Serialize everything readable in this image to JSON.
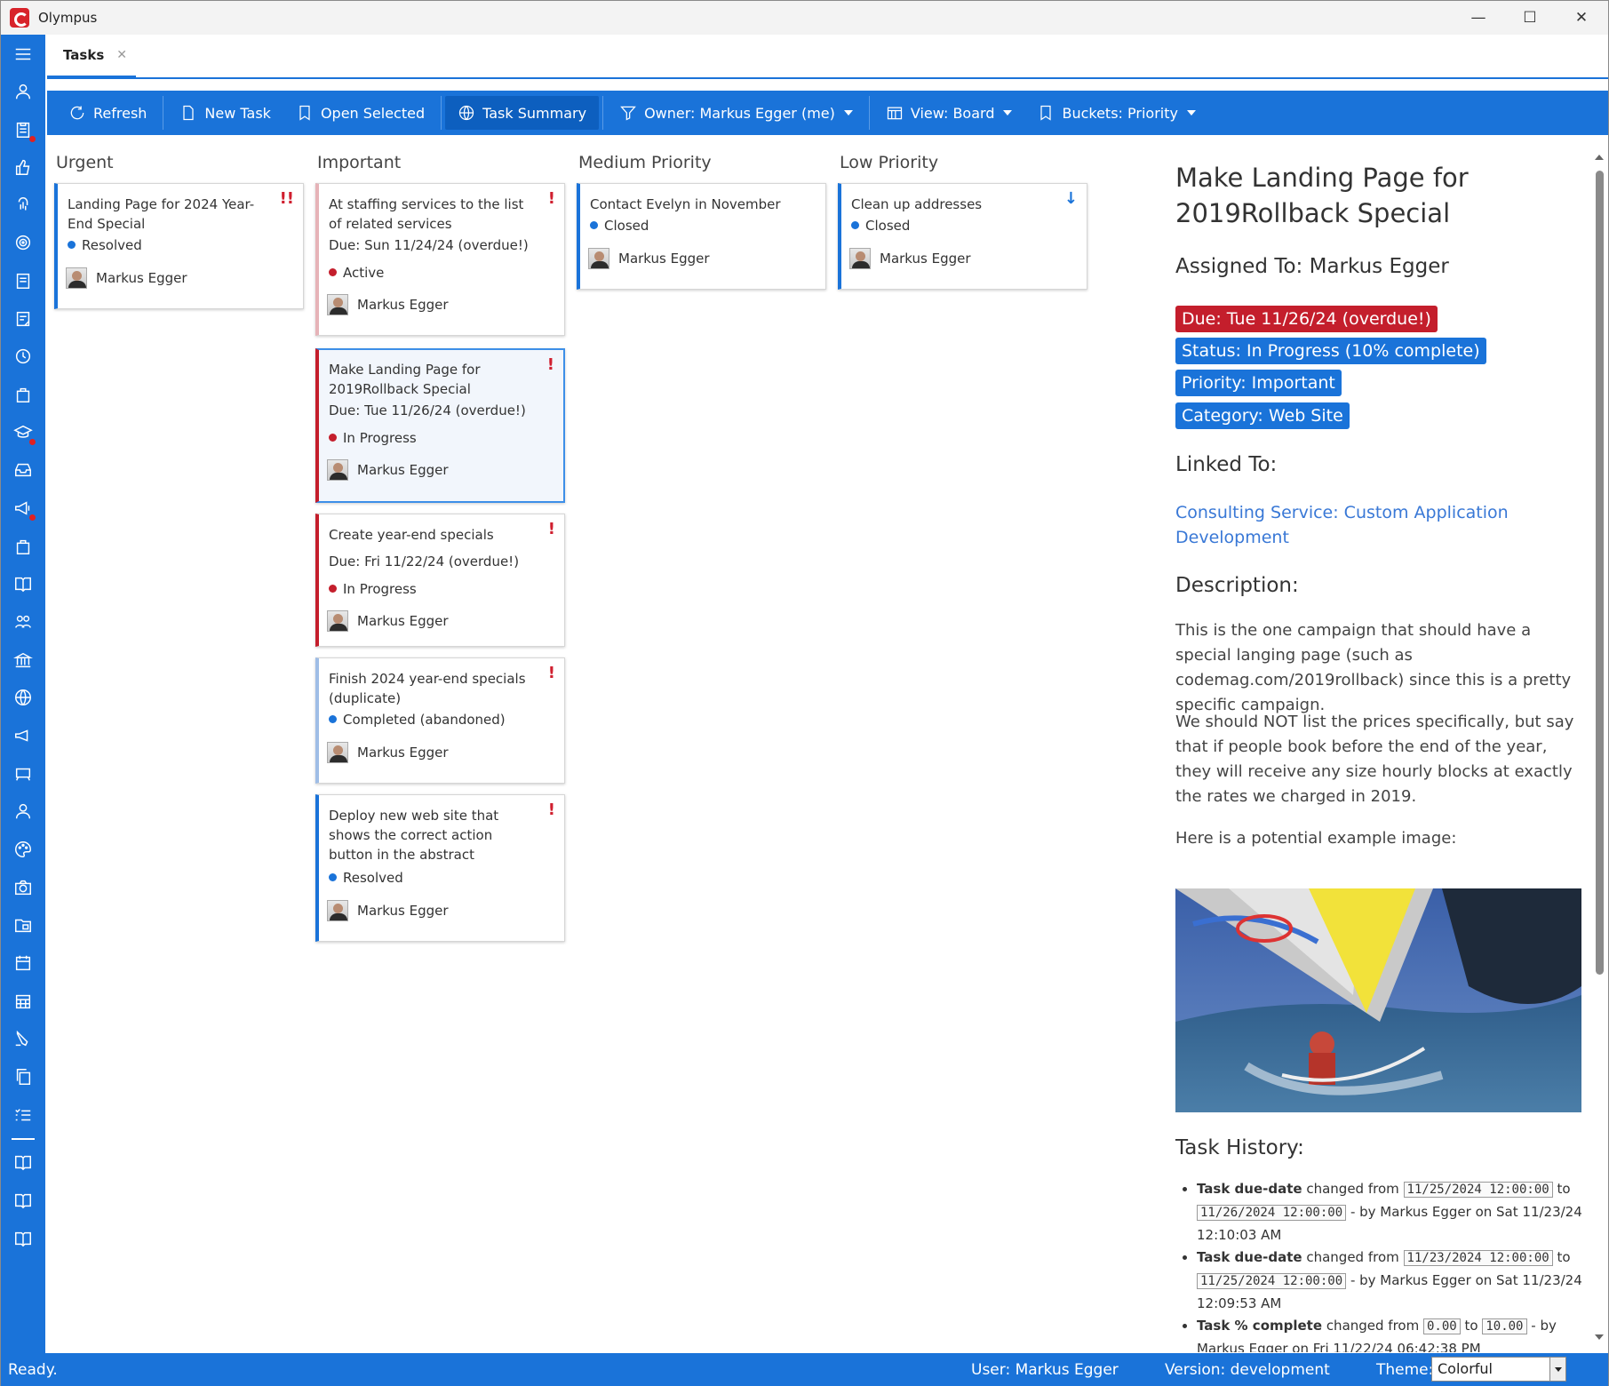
{
  "window": {
    "title": "Olympus"
  },
  "tabs": [
    {
      "label": "Tasks",
      "close": "✕"
    }
  ],
  "toolbar": {
    "refresh": "Refresh",
    "new_task": "New Task",
    "open_selected": "Open Selected",
    "task_summary": "Task Summary",
    "owner": "Owner: Markus Egger (me)",
    "view": "View: Board",
    "buckets": "Buckets: Priority"
  },
  "columns": [
    {
      "title": "Urgent"
    },
    {
      "title": "Important"
    },
    {
      "title": "Medium Priority"
    },
    {
      "title": "Low Priority"
    }
  ],
  "cards": {
    "urgent_1": {
      "title": "Landing Page for 2024 Year-End Special",
      "status": "Resolved",
      "user": "Markus Egger",
      "flag": "!!"
    },
    "imp_1": {
      "title": "At staffing services to the list of related services",
      "due": "Due: Sun 11/24/24 (overdue!)",
      "status": "Active",
      "user": "Markus Egger",
      "flag": "!"
    },
    "imp_2": {
      "title": "Make Landing Page for 2019Rollback Special",
      "due": "Due: Tue 11/26/24 (overdue!)",
      "status": "In Progress",
      "user": "Markus Egger",
      "flag": "!"
    },
    "imp_3": {
      "title": "Create year-end specials",
      "due": "Due: Fri 11/22/24 (overdue!)",
      "status": "In Progress",
      "user": "Markus Egger",
      "flag": "!"
    },
    "imp_4": {
      "title": "Finish 2024 year-end specials (duplicate)",
      "status": "Completed (abandoned)",
      "user": "Markus Egger",
      "flag": "!"
    },
    "imp_5": {
      "title": "Deploy new web site that shows the correct action button in the abstract",
      "status": "Resolved",
      "user": "Markus Egger",
      "flag": "!"
    },
    "med_1": {
      "title": "Contact Evelyn in November",
      "status": "Closed",
      "user": "Markus Egger"
    },
    "low_1": {
      "title": "Clean up addresses",
      "status": "Closed",
      "user": "Markus Egger",
      "flag": "↓"
    }
  },
  "details": {
    "title": "Make Landing Page for 2019Rollback Special",
    "assigned": "Assigned To: Markus Egger",
    "badges": {
      "due": "Due: Tue 11/26/24 (overdue!)",
      "status": "Status: In Progress (10% complete)",
      "priority": "Priority: Important",
      "category": "Category: Web Site"
    },
    "badge_colors": {
      "due": "#c41e2c",
      "info": "#1a73d9"
    },
    "linked_heading": "Linked To:",
    "linked_link": "Consulting Service: Custom Application Development",
    "description_heading": "Description:",
    "para1": "This is the one campaign that should have a special langing page (such as codemag.com/2019rollback) since this is a pretty specific campaign.",
    "para2": "We should NOT list the prices specifically, but say that if people book before the end of the year, they will receive any size hourly blocks at exactly the rates we charged in 2019.",
    "para3": "Here is a potential example image:",
    "history_heading": "Task History:",
    "history": [
      {
        "field": "Task due-date",
        "changed": "changed from",
        "from": "11/25/2024 12:00:00",
        "to_word": "to",
        "to": "11/26/2024 12:00:00",
        "by": "- by Markus Egger on Sat 11/23/24 12:10:03 AM"
      },
      {
        "field": "Task due-date",
        "changed": "changed from",
        "from": "11/23/2024 12:00:00",
        "to_word": "to",
        "to": "11/25/2024 12:00:00",
        "by": "- by Markus Egger on Sat 11/23/24 12:09:53 AM"
      },
      {
        "field": "Task % complete",
        "changed": "changed from",
        "from": "0.00",
        "to_word": "to",
        "to": "10.00",
        "by": "- by Markus Egger on Fri 11/22/24 06:42:38 PM"
      }
    ]
  },
  "statusbar": {
    "ready": "Ready.",
    "user": "User: Markus Egger",
    "version": "Version: development",
    "theme_label": "Theme:",
    "theme_value": "Colorful"
  },
  "colors": {
    "accent": "#1a73d9",
    "urgent": "#c41e2c"
  }
}
